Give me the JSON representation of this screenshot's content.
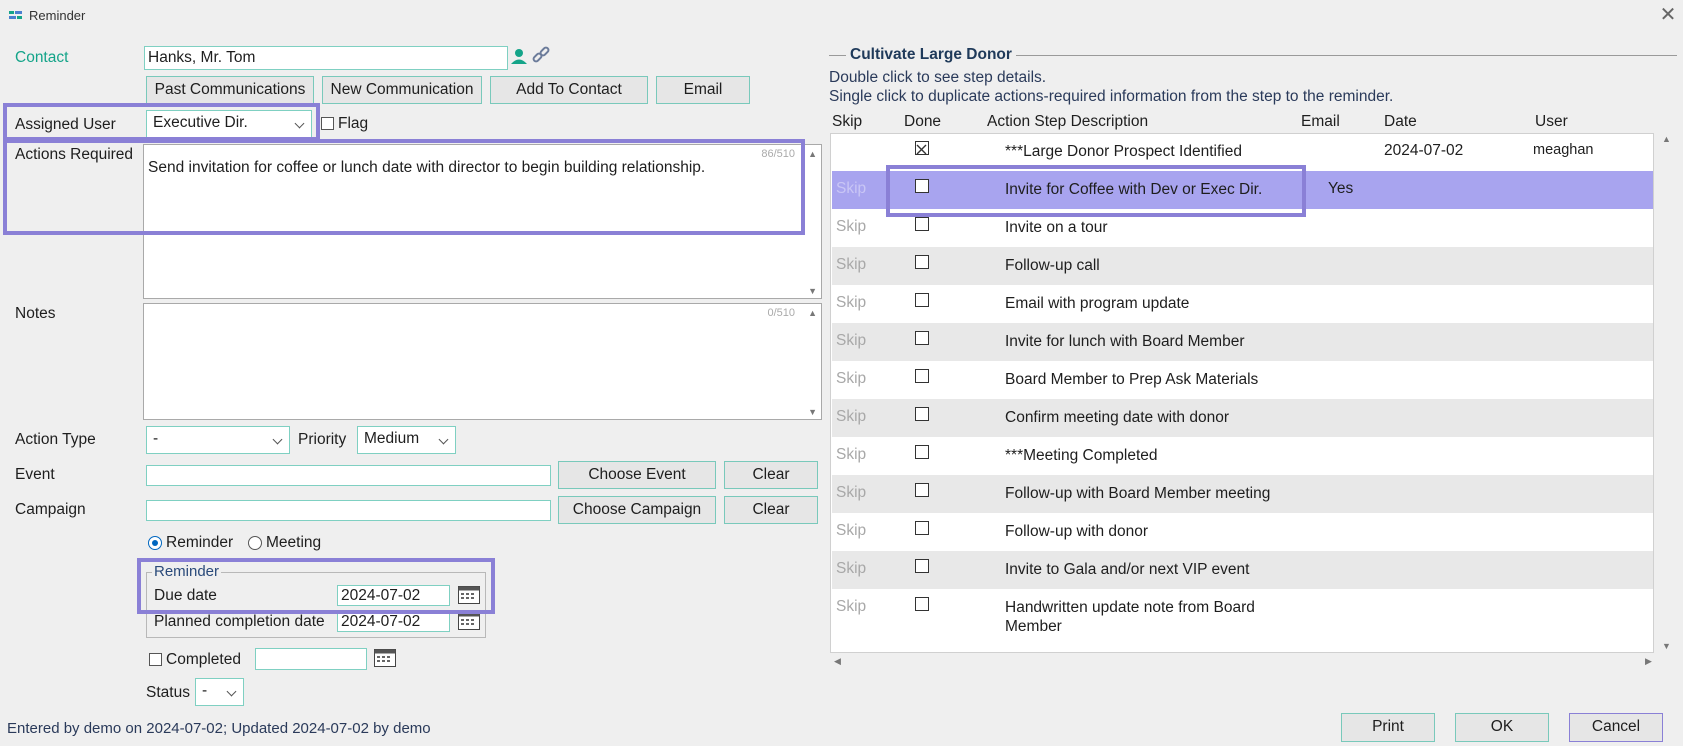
{
  "window": {
    "title": "Reminder",
    "close_glyph": "✕"
  },
  "contact": {
    "label": "Contact",
    "value": "Hanks, Mr. Tom"
  },
  "buttons": {
    "past_communications": "Past Communications",
    "new_communication": "New Communication",
    "add_to_contact": "Add To Contact",
    "email": "Email",
    "choose_event": "Choose Event",
    "clear_event": "Clear",
    "choose_campaign": "Choose Campaign",
    "clear_campaign": "Clear",
    "print": "Print",
    "ok": "OK",
    "cancel": "Cancel"
  },
  "assigned_user": {
    "label": "Assigned User",
    "value": "Executive Dir."
  },
  "flag": {
    "label": "Flag",
    "checked": false
  },
  "actions_required": {
    "label": "Actions Required",
    "value": "Send invitation for coffee or lunch date with director to begin building relationship.",
    "counter": "86/510"
  },
  "notes": {
    "label": "Notes",
    "value": "",
    "counter": "0/510"
  },
  "action_type": {
    "label": "Action Type",
    "value": "-"
  },
  "priority": {
    "label": "Priority",
    "value": "Medium"
  },
  "event": {
    "label": "Event",
    "value": ""
  },
  "campaign": {
    "label": "Campaign",
    "value": ""
  },
  "mode": {
    "reminder_label": "Reminder",
    "meeting_label": "Meeting",
    "selected": "Reminder"
  },
  "reminder_group": {
    "legend": "Reminder",
    "due_date_label": "Due date",
    "due_date": "2024-07-02",
    "planned_label": "Planned completion date",
    "planned_date": "2024-07-02"
  },
  "completed": {
    "label": "Completed",
    "checked": false,
    "date": ""
  },
  "status": {
    "label": "Status",
    "value": "-"
  },
  "footer": {
    "entered_by": "Entered by demo on 2024-07-02; Updated 2024-07-02 by demo"
  },
  "steps_panel": {
    "title": "Cultivate Large Donor",
    "hint1": "Double click to see step details.",
    "hint2": "Single click to duplicate actions-required information from the step to the reminder.",
    "columns": {
      "skip": "Skip",
      "done": "Done",
      "description": "Action Step Description",
      "email": "Email",
      "date": "Date",
      "user": "User"
    },
    "rows": [
      {
        "skip": "",
        "done": true,
        "description": "***Large Donor Prospect Identified",
        "email": "",
        "date": "2024-07-02",
        "user": "meaghan"
      },
      {
        "skip": "Skip",
        "done": false,
        "description": "Invite for Coffee with Dev or Exec Dir.",
        "email": "Yes",
        "date": "",
        "user": ""
      },
      {
        "skip": "Skip",
        "done": false,
        "description": "Invite on a tour",
        "email": "",
        "date": "",
        "user": ""
      },
      {
        "skip": "Skip",
        "done": false,
        "description": "Follow-up call",
        "email": "",
        "date": "",
        "user": ""
      },
      {
        "skip": "Skip",
        "done": false,
        "description": "Email with program update",
        "email": "",
        "date": "",
        "user": ""
      },
      {
        "skip": "Skip",
        "done": false,
        "description": "Invite for lunch with Board Member",
        "email": "",
        "date": "",
        "user": ""
      },
      {
        "skip": "Skip",
        "done": false,
        "description": "Board Member to Prep Ask Materials",
        "email": "",
        "date": "",
        "user": ""
      },
      {
        "skip": "Skip",
        "done": false,
        "description": "Confirm meeting date with donor",
        "email": "",
        "date": "",
        "user": ""
      },
      {
        "skip": "Skip",
        "done": false,
        "description": "***Meeting Completed",
        "email": "",
        "date": "",
        "user": ""
      },
      {
        "skip": "Skip",
        "done": false,
        "description": "Follow-up with Board Member meeting",
        "email": "",
        "date": "",
        "user": ""
      },
      {
        "skip": "Skip",
        "done": false,
        "description": "Follow-up with donor",
        "email": "",
        "date": "",
        "user": ""
      },
      {
        "skip": "Skip",
        "done": false,
        "description": "Invite to Gala and/or next VIP event",
        "email": "",
        "date": "",
        "user": ""
      },
      {
        "skip": "Skip",
        "done": false,
        "description": "Handwritten update note from Board Member",
        "email": "",
        "date": "",
        "user": ""
      }
    ]
  },
  "colors": {
    "accent": "#14a489",
    "highlight": "#8a80d6",
    "selected_row": "#a8a4ef"
  }
}
